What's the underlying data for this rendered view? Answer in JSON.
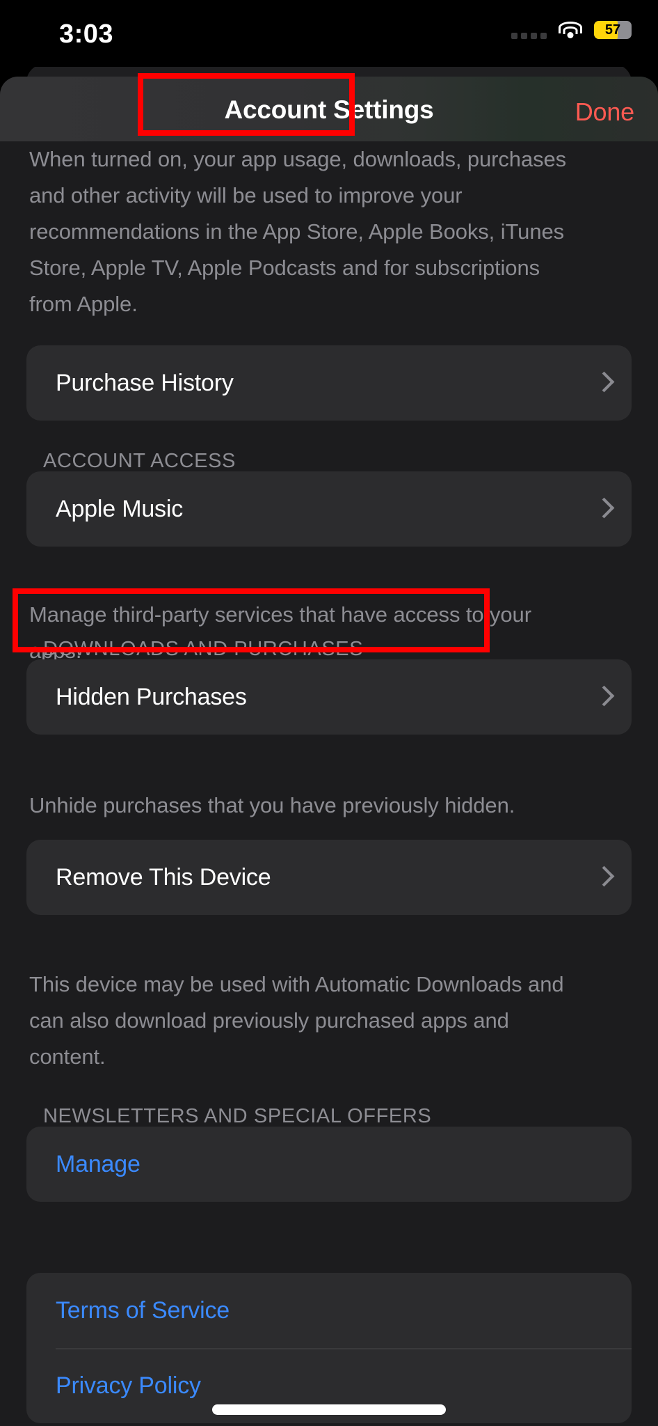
{
  "status_bar": {
    "time": "3:03",
    "signal_icon": "cellular-dots-icon",
    "wifi_icon": "wifi-icon",
    "battery_level": "57",
    "battery_low_power_color": "#ffd60a"
  },
  "nav": {
    "title": "Account Settings",
    "done_label": "Done",
    "done_color": "#ff5a52"
  },
  "content": {
    "personalized_footer": "When turned on, your app usage, downloads, purchases and other activity will be used to improve your recommendations in the App Store, Apple Books, iTunes Store, Apple TV, Apple Podcasts and for subscriptions from Apple.",
    "purchase_history_label": "Purchase History",
    "account_access_header": "ACCOUNT ACCESS",
    "apple_music_label": "Apple Music",
    "account_access_footer": "Manage third-party services that have access to your apps.",
    "downloads_header": "DOWNLOADS AND PURCHASES",
    "hidden_purchases_label": "Hidden Purchases",
    "hidden_purchases_footer": "Unhide purchases that you have previously hidden.",
    "remove_device_label": "Remove This Device",
    "remove_device_footer": "This device may be used with Automatic Downloads and can also download previously purchased apps and content.",
    "newsletters_header": "NEWSLETTERS AND SPECIAL OFFERS",
    "manage_label": "Manage",
    "terms_label": "Terms of Service",
    "privacy_label": "Privacy Policy",
    "link_color": "#3b8aff"
  },
  "annotations": {
    "highlight_color": "#ff0000",
    "boxes": [
      {
        "target": "Account Settings"
      },
      {
        "target": "Hidden Purchases"
      }
    ]
  }
}
